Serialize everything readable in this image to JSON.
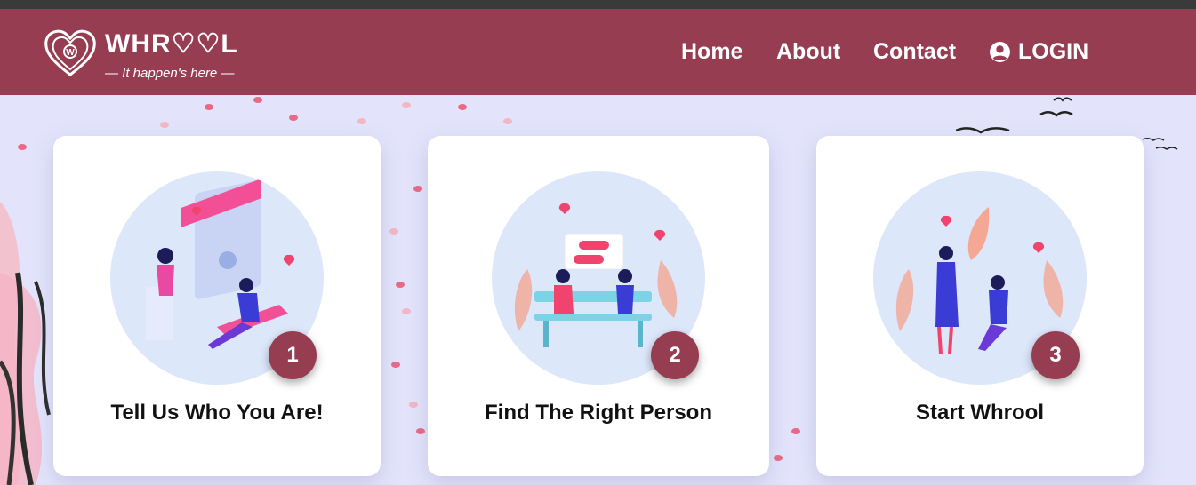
{
  "brand": {
    "name": "WHR♡♡L",
    "tagline": "— It happen's here —"
  },
  "nav": {
    "links": [
      "Home",
      "About",
      "Contact"
    ],
    "login_label": "LOGIN"
  },
  "steps": [
    {
      "number": "1",
      "title": "Tell Us Who You Are!"
    },
    {
      "number": "2",
      "title": "Find The Right Person"
    },
    {
      "number": "3",
      "title": "Start Whrool"
    }
  ],
  "colors": {
    "brand": "#973d52",
    "background": "#e3e4fb",
    "topbar": "#3a3a3a"
  }
}
